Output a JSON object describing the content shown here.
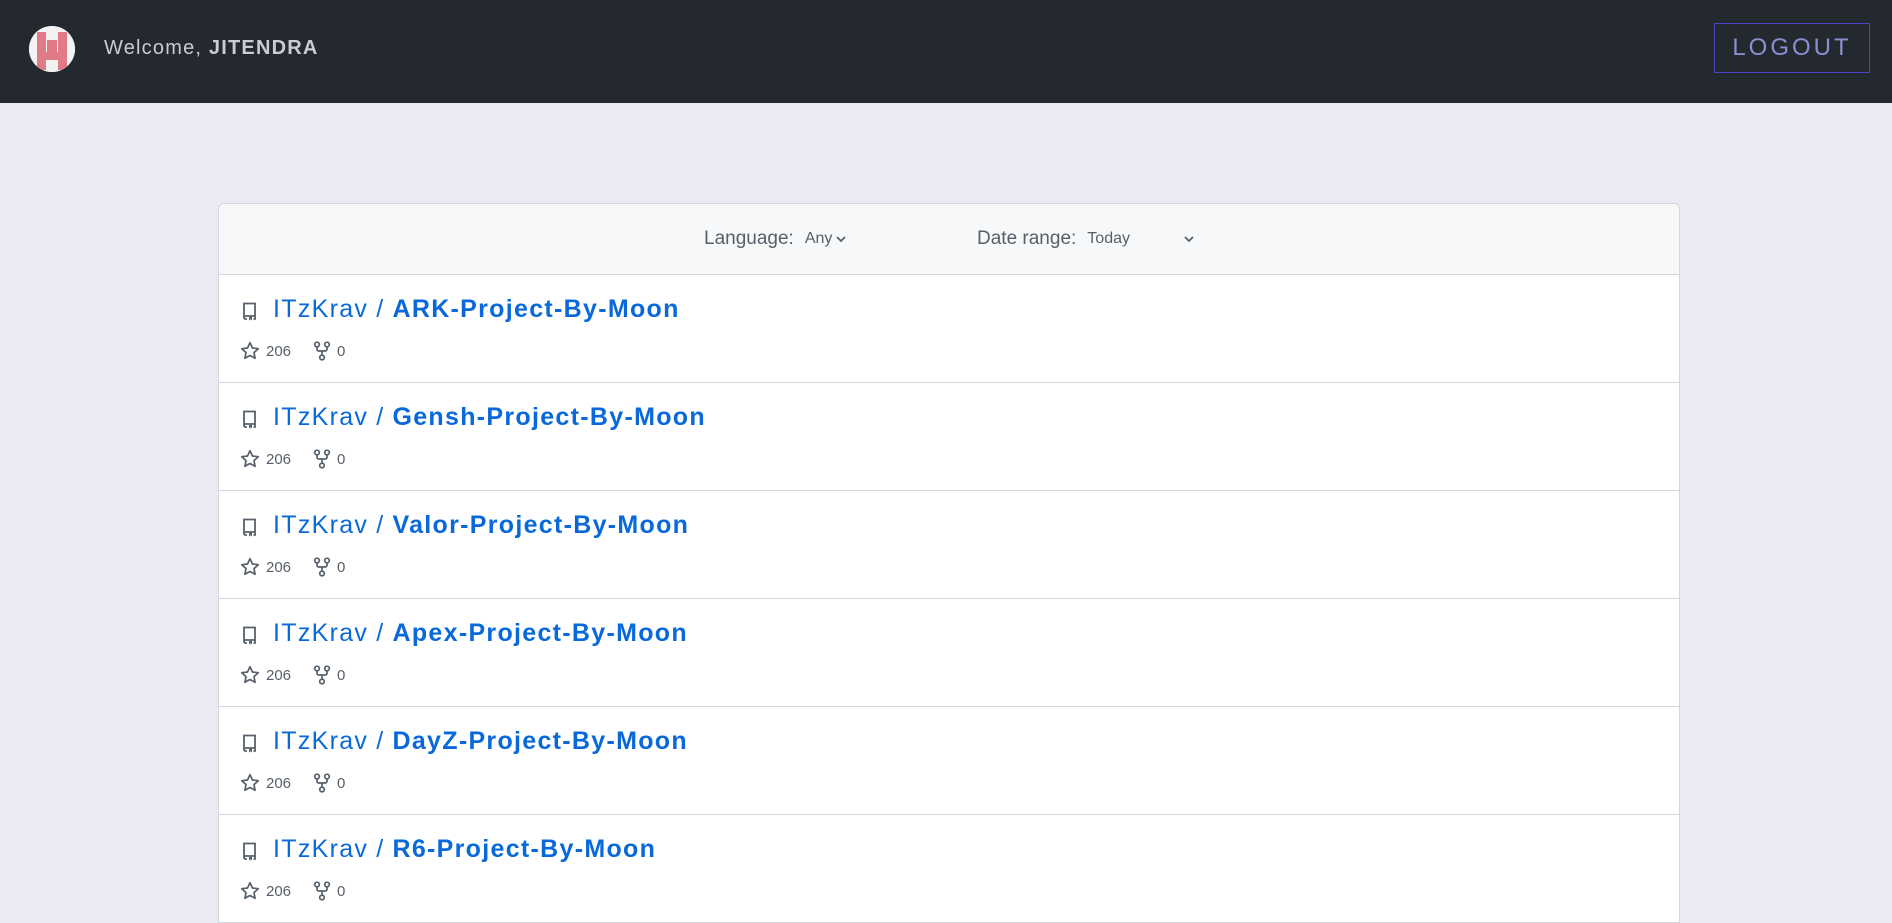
{
  "header": {
    "welcome_prefix": "Welcome,",
    "username": "JITENDRA",
    "logout_label": "LOGOUT"
  },
  "filters": {
    "language_label": "Language:",
    "language_value": "Any",
    "date_label": "Date range:",
    "date_value": "Today"
  },
  "repos": [
    {
      "owner": "ITzKrav",
      "separator": "/",
      "name": "ARK-Project-By-Moon",
      "stars": "206",
      "forks": "0"
    },
    {
      "owner": "ITzKrav",
      "separator": "/",
      "name": "Gensh-Project-By-Moon",
      "stars": "206",
      "forks": "0"
    },
    {
      "owner": "ITzKrav",
      "separator": "/",
      "name": "Valor-Project-By-Moon",
      "stars": "206",
      "forks": "0"
    },
    {
      "owner": "ITzKrav",
      "separator": "/",
      "name": "Apex-Project-By-Moon",
      "stars": "206",
      "forks": "0"
    },
    {
      "owner": "ITzKrav",
      "separator": "/",
      "name": "DayZ-Project-By-Moon",
      "stars": "206",
      "forks": "0"
    },
    {
      "owner": "ITzKrav",
      "separator": "/",
      "name": "R6-Project-By-Moon",
      "stars": "206",
      "forks": "0"
    }
  ],
  "icons": {
    "avatar": "user-avatar",
    "repo": "repo-icon",
    "star": "star-icon",
    "fork": "fork-icon",
    "chevron": "chevron-down-icon"
  },
  "colors": {
    "topbar": "#24292f",
    "link": "#0969da",
    "logout_border": "#4a44c8",
    "background": "#ebeaf3"
  }
}
